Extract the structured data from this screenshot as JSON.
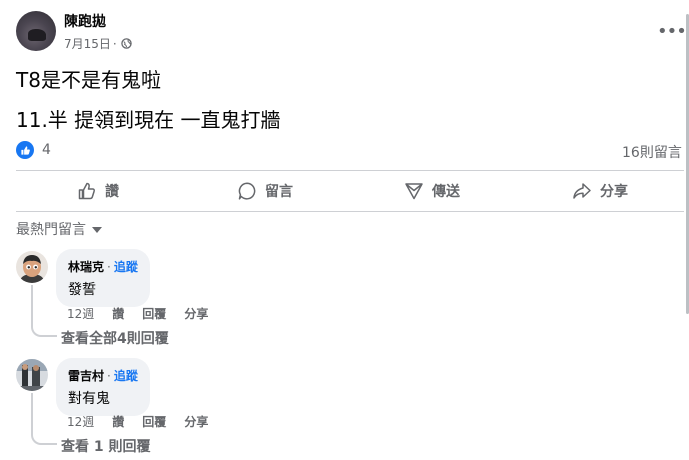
{
  "post": {
    "author": "陳跑拋",
    "date": "7月15日",
    "separator": "·",
    "more_label": "•••",
    "lines": [
      "T8是不是有鬼啦",
      "11.半 提領到現在 一直鬼打牆"
    ],
    "reaction_count": "4",
    "comment_count": "16則留言"
  },
  "actions": {
    "like": "讚",
    "comment": "留言",
    "send": "傳送",
    "share": "分享"
  },
  "sort_label": "最熱門留言",
  "comments": [
    {
      "name": "林瑞克",
      "follow": "追蹤",
      "text": "發誓",
      "time": "12週",
      "like": "讚",
      "reply": "回覆",
      "share": "分享",
      "view_replies": "查看全部4則回覆"
    },
    {
      "name": "雷吉村",
      "follow": "追蹤",
      "text": "對有鬼",
      "time": "12週",
      "like": "讚",
      "reply": "回覆",
      "share": "分享",
      "view_replies": "查看 1 則回覆"
    }
  ],
  "colors": {
    "accent": "#1877f2",
    "secondary_text": "#65676b",
    "bubble": "#f0f2f5",
    "divider": "#ced0d4"
  },
  "icons": [
    "globe-icon",
    "like-icon",
    "comment-icon",
    "send-icon",
    "share-icon",
    "caret-down-icon",
    "more-icon"
  ]
}
